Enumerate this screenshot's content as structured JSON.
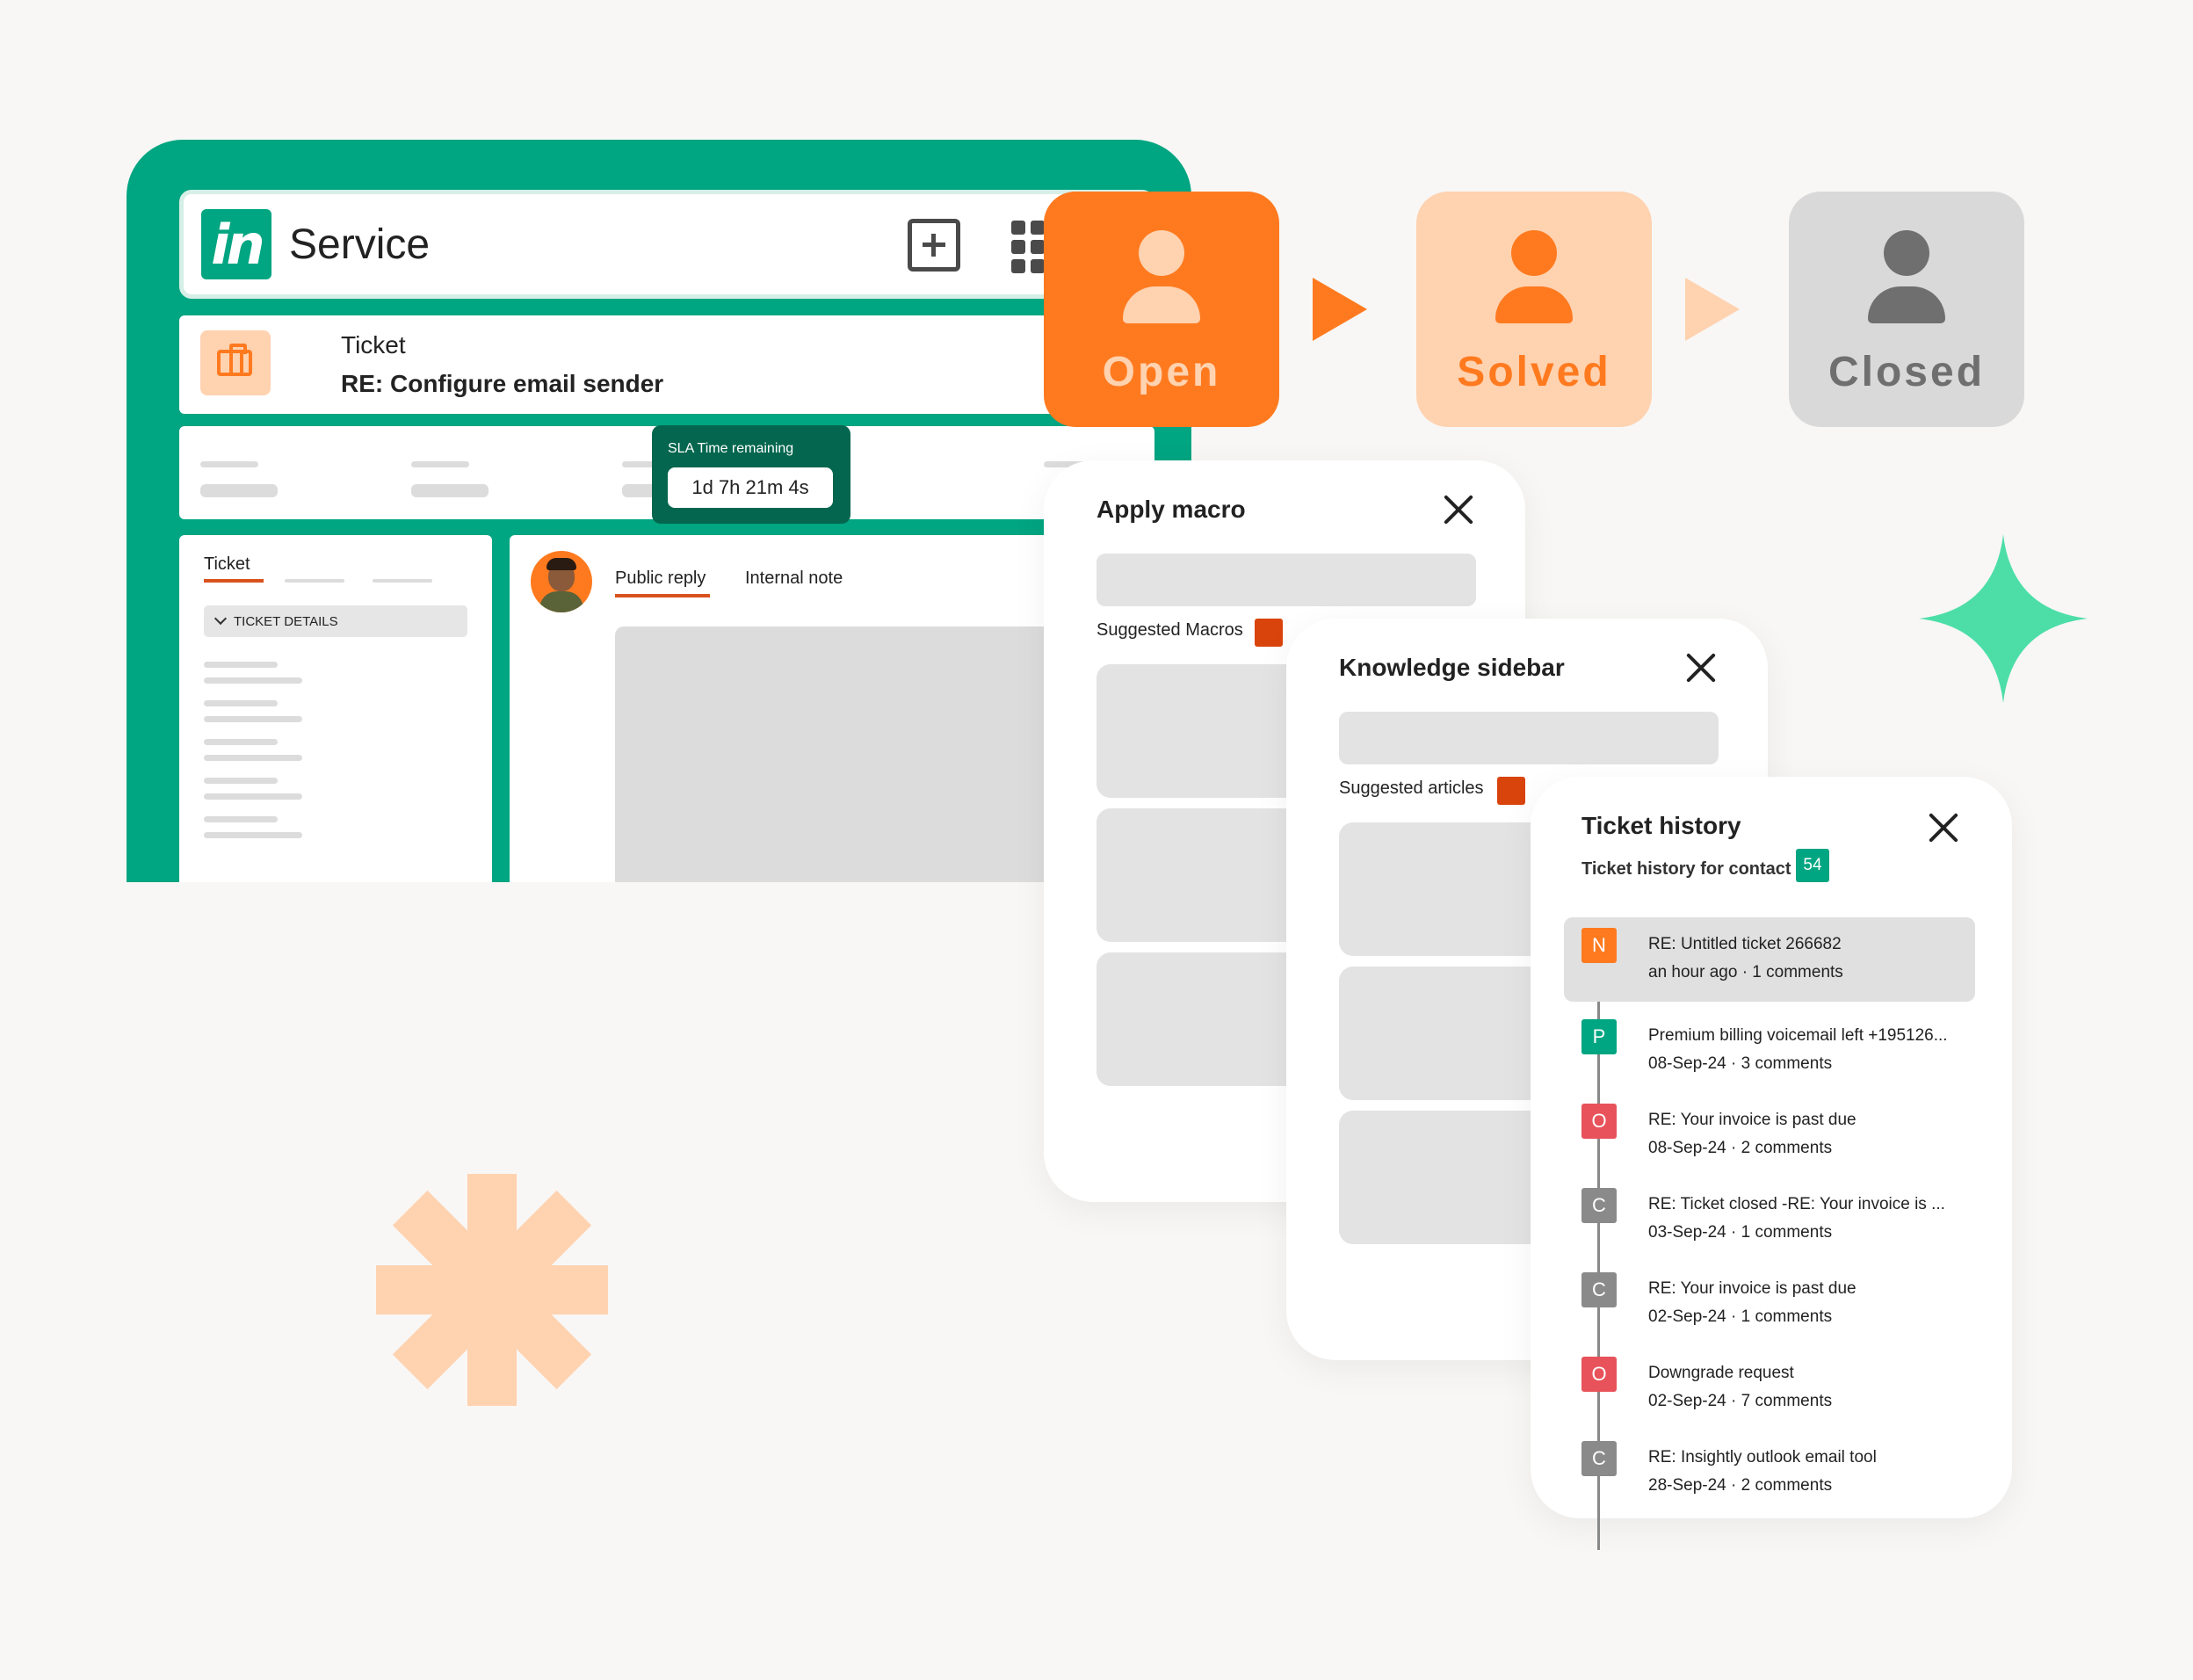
{
  "app": {
    "name": "Service",
    "logo_text": "in"
  },
  "ticket": {
    "type_label": "Ticket",
    "subject": "RE: Configure email sender"
  },
  "sla": {
    "label": "SLA Time remaining",
    "value": "1d 7h 21m 4s"
  },
  "left_panel": {
    "tab_label": "Ticket",
    "section_label": "TICKET DETAILS"
  },
  "reply_panel": {
    "tabs": [
      "Public reply",
      "Internal note"
    ]
  },
  "status_flow": [
    {
      "label": "Open",
      "color": "#ff7a1f"
    },
    {
      "label": "Solved",
      "color": "#ffd2b0"
    },
    {
      "label": "Closed",
      "color": "#d9d9d9"
    }
  ],
  "macro_card": {
    "title": "Apply macro",
    "suggest_label": "Suggested Macros"
  },
  "kb_card": {
    "title": "Knowledge sidebar",
    "suggest_label": "Suggested articles"
  },
  "history_card": {
    "title": "Ticket history",
    "subtitle": "Ticket history for contact",
    "count": "54",
    "items": [
      {
        "badge": "N",
        "badge_color": "#ff7a1f",
        "title": "RE: Untitled ticket 266682",
        "meta": "an hour ago · 1 comments"
      },
      {
        "badge": "P",
        "badge_color": "#00a581",
        "title": "Premium billing voicemail left +195126...",
        "meta": "08-Sep-24 · 3 comments"
      },
      {
        "badge": "O",
        "badge_color": "#e8525a",
        "title": "RE: Your invoice is past due",
        "meta": "08-Sep-24 · 2 comments"
      },
      {
        "badge": "C",
        "badge_color": "#8a8a8a",
        "title": "RE: Ticket closed -RE: Your invoice is ...",
        "meta": "03-Sep-24 · 1 comments"
      },
      {
        "badge": "C",
        "badge_color": "#8a8a8a",
        "title": "RE: Your invoice is past due",
        "meta": "02-Sep-24 · 1 comments"
      },
      {
        "badge": "O",
        "badge_color": "#e8525a",
        "title": "Downgrade request",
        "meta": "02-Sep-24 · 7 comments"
      },
      {
        "badge": "C",
        "badge_color": "#8a8a8a",
        "title": "RE: Insightly outlook email tool",
        "meta": "28-Sep-24 · 2 comments"
      }
    ]
  },
  "colors": {
    "brand_green": "#00a581",
    "accent_orange": "#ff7a1f",
    "peach": "#ffd2b0",
    "mint": "#4ddea8"
  }
}
